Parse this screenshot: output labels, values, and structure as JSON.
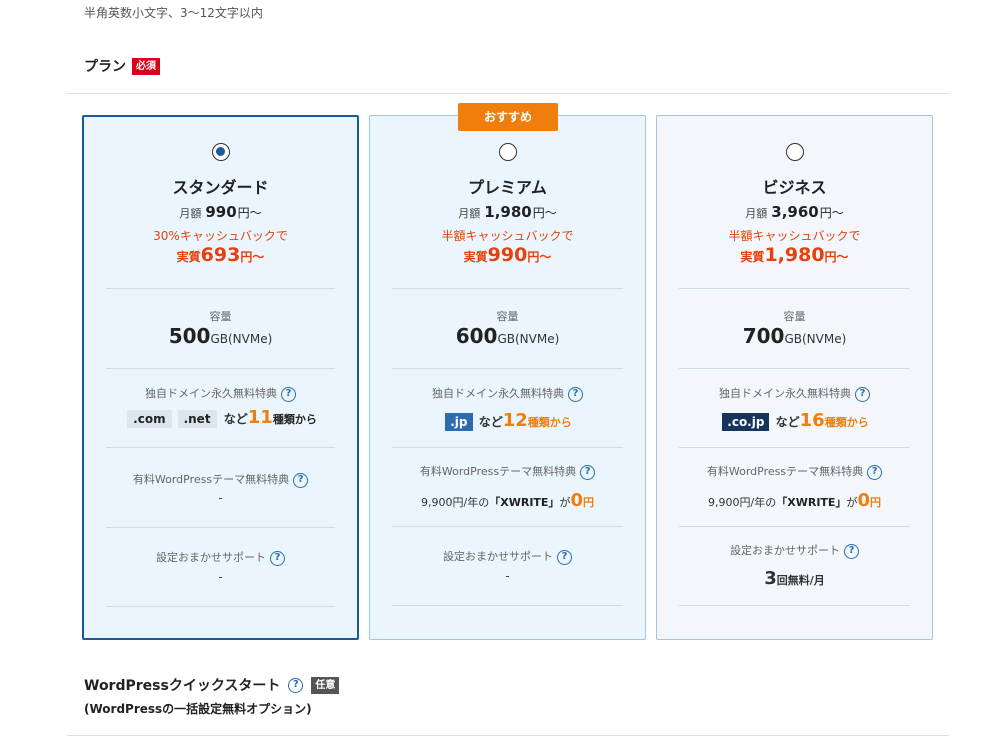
{
  "hint": "半角英数小文字、3〜12文字以内",
  "plan_section": {
    "title": "プラン",
    "required_badge": "必須"
  },
  "common": {
    "monthly_label": "月額",
    "yen_from": "円〜",
    "effective_label": "実質",
    "capacity_label": "容量",
    "capacity_unit": "GB(NVMe)",
    "domain_label": "独自ドメイン永久無料特典",
    "theme_label": "有料WordPressテーマ無料特典",
    "support_label": "設定おまかせサポート",
    "help_glyph": "?",
    "nado": "など",
    "kinds_from": "種類から",
    "dash": "-"
  },
  "plans": [
    {
      "name": "スタンダード",
      "price": "990",
      "cashback": "30%キャッシュバックで",
      "effective": "693",
      "capacity": "500",
      "domain_tags": [
        ".com",
        ".net"
      ],
      "domain_count": "11",
      "theme": "-",
      "support": "-",
      "selected": true
    },
    {
      "name": "プレミアム",
      "badge": "おすすめ",
      "price": "1,980",
      "cashback": "半額キャッシュバックで",
      "effective": "990",
      "capacity": "600",
      "domain_tags": [
        ".jp"
      ],
      "domain_count": "12",
      "theme_price": "9,900円/年の",
      "theme_name": "「XWRITE」",
      "theme_ga": "が",
      "theme_zero": "0",
      "theme_yen": "円",
      "support": "-",
      "selected": false
    },
    {
      "name": "ビジネス",
      "price": "3,960",
      "cashback": "半額キャッシュバックで",
      "effective": "1,980",
      "capacity": "700",
      "domain_tags": [
        ".co.jp"
      ],
      "domain_count": "16",
      "theme_price": "9,900円/年の",
      "theme_name": "「XWRITE」",
      "theme_ga": "が",
      "theme_zero": "0",
      "theme_yen": "円",
      "support_count": "3",
      "support_unit": "回無料/月",
      "selected": false
    }
  ],
  "quickstart": {
    "title": "WordPressクイックスタート",
    "optional_badge": "任意",
    "subtitle": "(WordPressの一括設定無料オプション)"
  }
}
